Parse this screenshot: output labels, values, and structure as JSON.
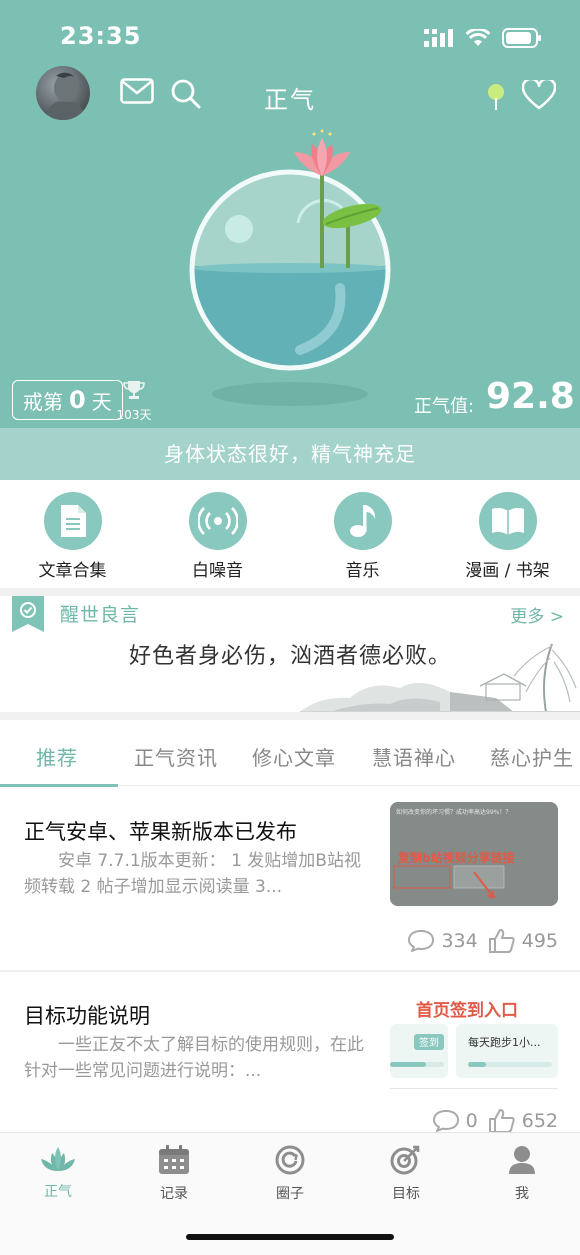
{
  "status": {
    "time": "23:35"
  },
  "header": {
    "title": "正气"
  },
  "hero": {
    "streak_prefix": "戒第",
    "streak_days": "0",
    "streak_suffix": "天",
    "best_days": "103天",
    "score_label": "正气值:",
    "score_value": "92.8",
    "state_text": "身体状态很好，精气神充足"
  },
  "quick": [
    {
      "label": "文章合集",
      "icon": "document-icon"
    },
    {
      "label": "白噪音",
      "icon": "radio-icon"
    },
    {
      "label": "音乐",
      "icon": "music-note-icon"
    },
    {
      "label": "漫画 / 书架",
      "icon": "book-icon"
    }
  ],
  "quote": {
    "heading": "醒世良言",
    "more": "更多 >",
    "text": "好色者身必伤，汹酒者德必败。"
  },
  "tabs": [
    "推荐",
    "正气资讯",
    "修心文章",
    "慧语禅心",
    "慈心护生"
  ],
  "articles": [
    {
      "title": "正气安卓、苹果新版本已发布",
      "summary": "安卓 7.7.1版本更新： 1 发贴增加B站视频转载 2 帖子增加显示阅读量 3...",
      "thumb_question": "如何改变你的坏习惯？成功率高达99%！？",
      "thumb_annotation": "复制b站视频分享链接",
      "comments": "334",
      "likes": "495"
    },
    {
      "title": "目标功能说明",
      "summary": "一些正友不太了解目标的使用规则，在此针对一些常见问题进行说明：...",
      "thumb_heading": "首页签到入口",
      "thumb_signin": "签到",
      "thumb_goal": "每天跑步1小...",
      "comments": "0",
      "likes": "652"
    }
  ],
  "tabbar": [
    {
      "label": "正气",
      "icon": "lotus-icon"
    },
    {
      "label": "记录",
      "icon": "calendar-icon"
    },
    {
      "label": "圈子",
      "icon": "circle-refresh-icon"
    },
    {
      "label": "目标",
      "icon": "target-icon"
    },
    {
      "label": "我",
      "icon": "user-icon"
    }
  ],
  "colors": {
    "primary": "#7cc0b3",
    "accent_text": "#6fb7a9",
    "state_bar": "#a4d3cb",
    "annotation_red": "#e05a47"
  }
}
